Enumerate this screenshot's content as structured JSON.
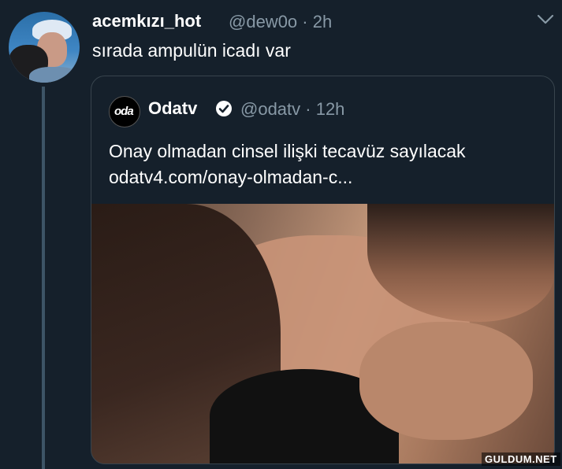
{
  "tweet": {
    "display_name": "acemkızı_hot",
    "handle_time": "@dew0o · 2h",
    "text": "sırada ampulün icadı var",
    "menu_icon": "chevron-down-icon"
  },
  "quoted_tweet": {
    "display_name": "Odatv",
    "avatar_text": "oda",
    "verified_icon": "verified-badge-icon",
    "handle_time": "@odatv · 12h",
    "text_line1": "Onay olmadan cinsel ilişki tecavüz sayılacak",
    "text_line2": "odatv4.com/onay-olmadan-c..."
  },
  "watermark": "GULDUM.NET",
  "colors": {
    "background": "#15202b",
    "secondary_text": "#8899a6",
    "border": "#38444d"
  }
}
